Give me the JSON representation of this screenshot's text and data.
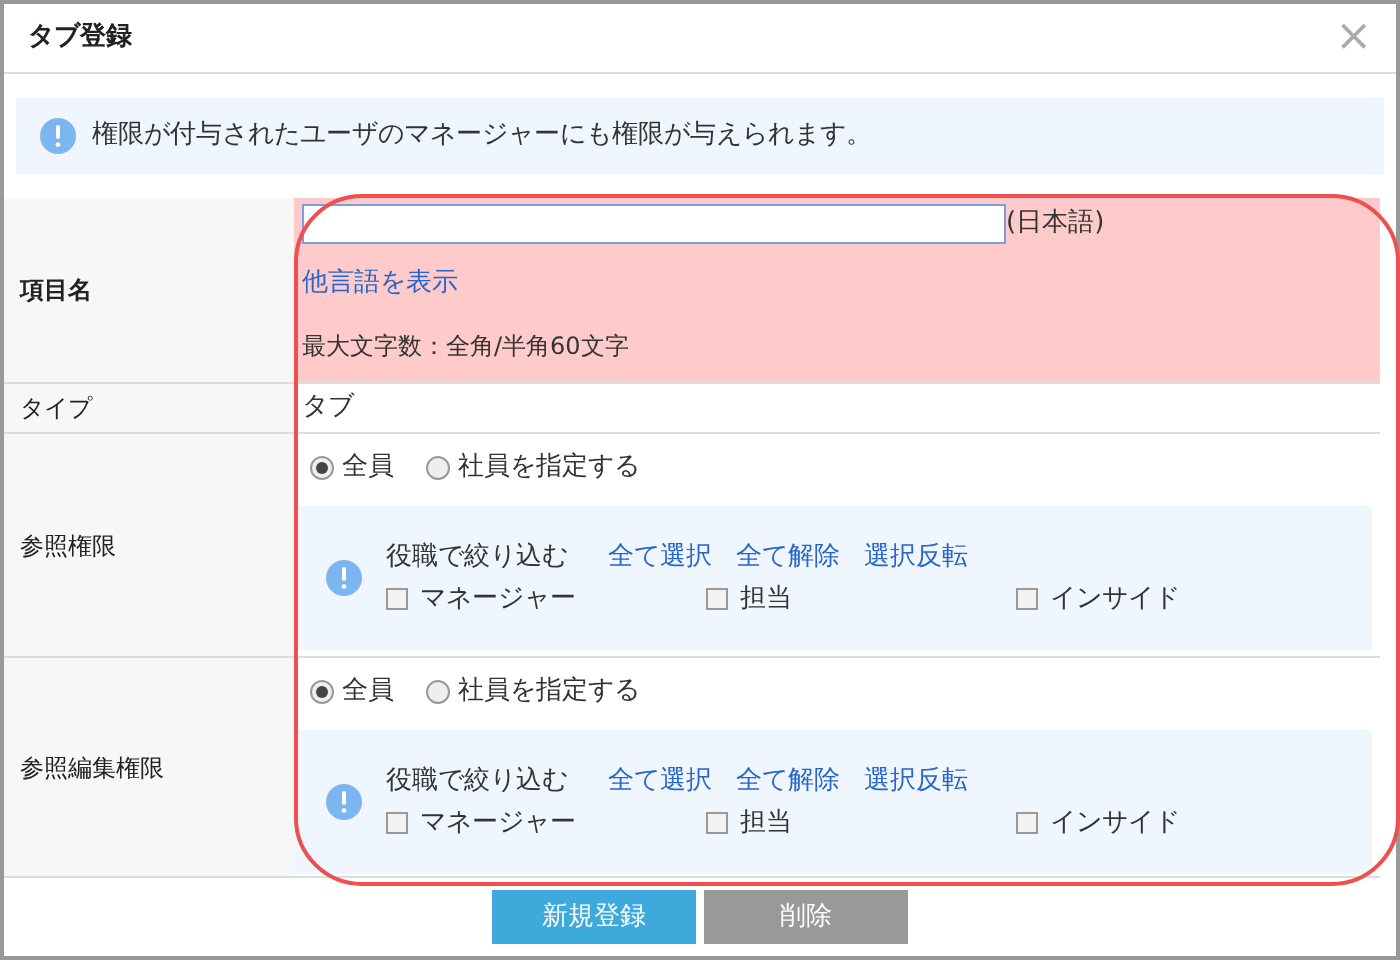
{
  "dialog": {
    "title": "タブ登録",
    "close": "×"
  },
  "notice": {
    "text": "権限が付与されたユーザのマネージャーにも権限が与えられます。"
  },
  "rows": [
    {
      "kind": "name",
      "label": "項目名",
      "highlighted": true,
      "suffix": "(日本語)",
      "link": "他言語を表示",
      "note": "最大文字数：全角/半角60文字"
    },
    {
      "kind": "text",
      "label": "タイプ",
      "value": "タブ"
    },
    {
      "kind": "permission",
      "label": "参照権限",
      "radios": [
        {
          "label": "全員",
          "selected": true
        },
        {
          "label": "社員を指定する",
          "selected": false
        }
      ],
      "filter": {
        "label": "役職で絞り込む",
        "links": [
          "全て選択",
          "全て解除",
          "選択反転"
        ],
        "checkboxes": [
          {
            "label": "マネージャー",
            "checked": false
          },
          {
            "label": "担当",
            "checked": false
          },
          {
            "label": "インサイド",
            "checked": false
          }
        ]
      }
    },
    {
      "kind": "permission",
      "label": "参照編集権限",
      "radios": [
        {
          "label": "全員",
          "selected": true
        },
        {
          "label": "社員を指定する",
          "selected": false
        }
      ],
      "filter": {
        "label": "役職で絞り込む",
        "links": [
          "全て選択",
          "全て解除",
          "選択反転"
        ],
        "checkboxes": [
          {
            "label": "マネージャー",
            "checked": false
          },
          {
            "label": "担当",
            "checked": false
          },
          {
            "label": "インサイド",
            "checked": false
          }
        ]
      }
    }
  ],
  "buttons": [
    {
      "label": "新規登録",
      "kind": "primary"
    },
    {
      "label": "削除",
      "kind": "secondary"
    }
  ]
}
